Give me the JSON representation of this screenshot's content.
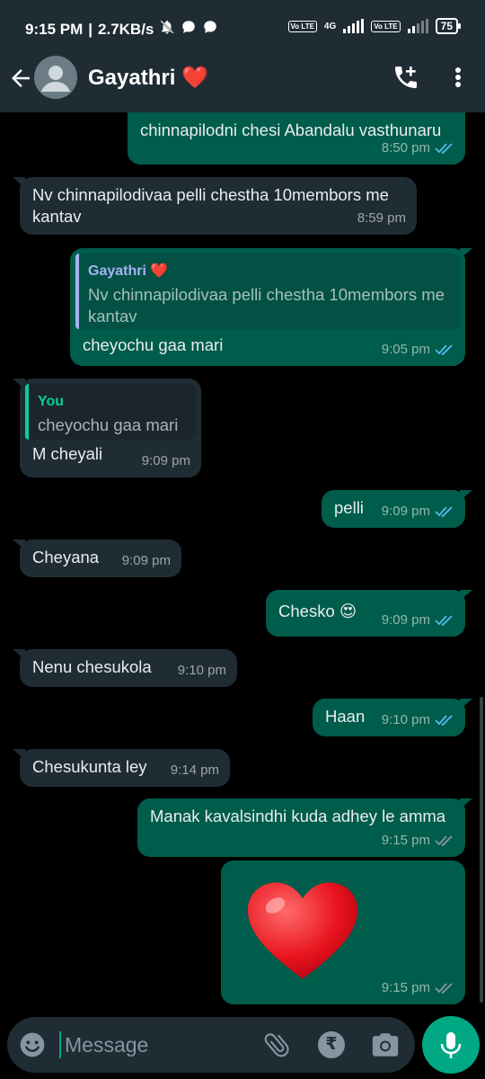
{
  "status_bar": {
    "time": "9:15 PM",
    "speed": "2.7KB/s",
    "network_type": "4G",
    "volte_label": "Vo LTE",
    "battery": "75"
  },
  "header": {
    "contact_name": "Gayathri",
    "name_emoji": "❤️"
  },
  "messages": [
    {
      "dir": "out",
      "text": "chinnapilodni chesi Abandalu vasthunaru",
      "time": "8:50 pm",
      "status": "read"
    },
    {
      "dir": "in",
      "text": "Nv chinnapilodivaa pelli chestha 10membors me kantav",
      "time": "8:59 pm"
    },
    {
      "dir": "out",
      "quote_author": "Gayathri ❤️",
      "quote_text": "Nv chinnapilodivaa pelli chestha 10membors me kantav",
      "text": "cheyochu gaa mari",
      "time": "9:05 pm",
      "status": "read"
    },
    {
      "dir": "in",
      "quote_author": "You",
      "quote_text": "cheyochu gaa mari",
      "text": "M cheyali",
      "time": "9:09 pm"
    },
    {
      "dir": "out",
      "text": "pelli",
      "time": "9:09 pm",
      "status": "read"
    },
    {
      "dir": "in",
      "text": "Cheyana",
      "time": "9:09 pm"
    },
    {
      "dir": "out",
      "text": "Chesko 😍",
      "time": "9:09 pm",
      "status": "read"
    },
    {
      "dir": "in",
      "text": "Nenu chesukola",
      "time": "9:10 pm"
    },
    {
      "dir": "out",
      "text": "Haan",
      "time": "9:10 pm",
      "status": "read"
    },
    {
      "dir": "in",
      "text": "Chesukunta ley",
      "time": "9:14 pm"
    },
    {
      "dir": "out",
      "text": "Manak kavalsindhi kuda adhey le amma",
      "time": "9:15 pm",
      "status": "delivered"
    },
    {
      "dir": "out",
      "text": "❤️",
      "time": "9:15 pm",
      "status": "delivered",
      "kind": "big-emoji"
    }
  ],
  "composer": {
    "placeholder": "Message"
  },
  "colors": {
    "outgoing_bubble": "#005c4b",
    "incoming_bubble": "#1f2c34",
    "accent": "#00a884",
    "read_tick": "#53bdeb",
    "delivered_tick": "#8696a0"
  },
  "icons": [
    "back-arrow-icon",
    "avatar-icon",
    "add-call-icon",
    "more-vert-icon",
    "emoji-icon",
    "attach-icon",
    "rupee-icon",
    "camera-icon",
    "mic-icon"
  ]
}
